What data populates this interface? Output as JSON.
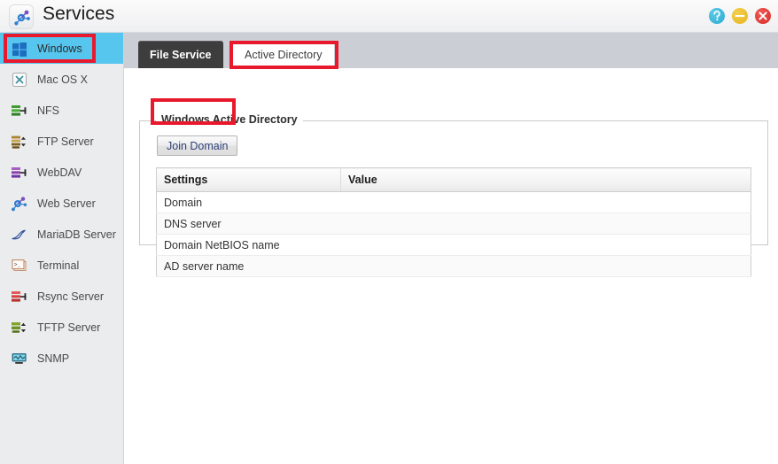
{
  "window": {
    "title": "Services",
    "app_icon": "services-node-icon",
    "controls": [
      {
        "name": "help-button",
        "glyph": "?",
        "color": "#29a9cf"
      },
      {
        "name": "minimize-button",
        "glyph": "−",
        "color": "#e8b420"
      },
      {
        "name": "close-button",
        "glyph": "×",
        "color": "#d52b28"
      }
    ]
  },
  "sidebar": {
    "items": [
      {
        "label": "Windows",
        "icon": "windows-logo-icon",
        "selected": true
      },
      {
        "label": "Mac OS X",
        "icon": "mac-x-icon",
        "selected": false
      },
      {
        "label": "NFS",
        "icon": "nfs-server-icon",
        "selected": false
      },
      {
        "label": "FTP Server",
        "icon": "ftp-server-icon",
        "selected": false
      },
      {
        "label": "WebDAV",
        "icon": "webdav-server-icon",
        "selected": false
      },
      {
        "label": "Web Server",
        "icon": "web-server-icon",
        "selected": false
      },
      {
        "label": "MariaDB Server",
        "icon": "mariadb-seal-icon",
        "selected": false
      },
      {
        "label": "Terminal",
        "icon": "terminal-icon",
        "selected": false
      },
      {
        "label": "Rsync Server",
        "icon": "rsync-server-icon",
        "selected": false
      },
      {
        "label": "TFTP Server",
        "icon": "tftp-server-icon",
        "selected": false
      },
      {
        "label": "SNMP",
        "icon": "snmp-monitor-icon",
        "selected": false
      }
    ]
  },
  "tabs": [
    {
      "label": "File Service",
      "active": false
    },
    {
      "label": "Active Directory",
      "active": true
    }
  ],
  "panel": {
    "legend": "Windows Active Directory",
    "join_button": "Join Domain",
    "table": {
      "headers": [
        "Settings",
        "Value"
      ],
      "rows": [
        {
          "setting": "Domain",
          "value": ""
        },
        {
          "setting": "DNS server",
          "value": ""
        },
        {
          "setting": "Domain NetBIOS name",
          "value": ""
        },
        {
          "setting": "AD server name",
          "value": ""
        }
      ]
    }
  },
  "annotations": {
    "accent_color": "#e8192c",
    "targets": [
      "sidebar-item-windows",
      "tab-active-directory",
      "join-domain-button"
    ]
  }
}
